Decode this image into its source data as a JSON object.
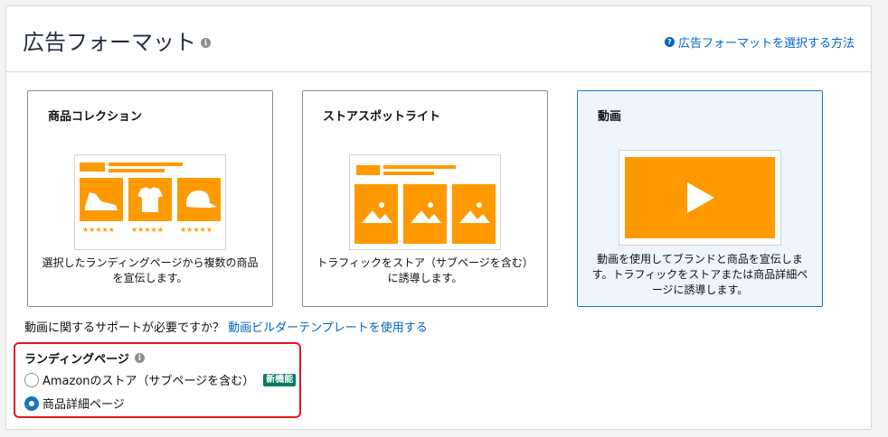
{
  "header": {
    "title": "広告フォーマット",
    "help_link": "広告フォーマットを選択する方法"
  },
  "cards": [
    {
      "title": "商品コレクション",
      "description": "選択したランディングページから複数の商品を宣伝します。",
      "selected": false
    },
    {
      "title": "ストアスポットライト",
      "description": "トラフィックをストア（サブページを含む）に誘導します。",
      "selected": false
    },
    {
      "title": "動画",
      "description": "動画を使用してブランドと商品を宣伝します。トラフィックをストアまたは商品詳細ページに誘導します。",
      "selected": true
    }
  ],
  "support": {
    "question": "動画に関するサポートが必要ですか？",
    "link": "動画ビルダーテンプレートを使用する"
  },
  "landing": {
    "title": "ランディングページ",
    "options": [
      {
        "label": "Amazonのストア（サブページを含む）",
        "badge": "新機能",
        "checked": false
      },
      {
        "label": "商品詳細ページ",
        "badge": "",
        "checked": true
      }
    ]
  },
  "colors": {
    "accent_orange": "#ff9900",
    "link_blue": "#0066c0",
    "selected_bg": "#edf6fd",
    "highlight_red": "#e3171e",
    "badge_green": "#067d62"
  }
}
